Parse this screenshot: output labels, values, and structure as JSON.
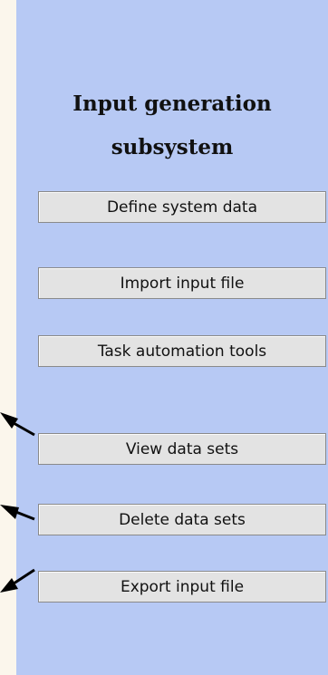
{
  "panel": {
    "title_line1": "Input generation",
    "title_line2": "subsystem",
    "buttons": [
      {
        "label": "Define system data"
      },
      {
        "label": "Import input file"
      },
      {
        "label": "Task automation tools"
      },
      {
        "label": "View data sets"
      },
      {
        "label": "Delete data sets"
      },
      {
        "label": "Export input file"
      }
    ]
  },
  "colors": {
    "page_background": "#fbf6ec",
    "panel_background": "#b7c9f4",
    "button_face": "#e3e3e3",
    "arrow": "#000000"
  },
  "icons": [
    "arrow-icon",
    "arrow-icon",
    "arrow-icon"
  ]
}
